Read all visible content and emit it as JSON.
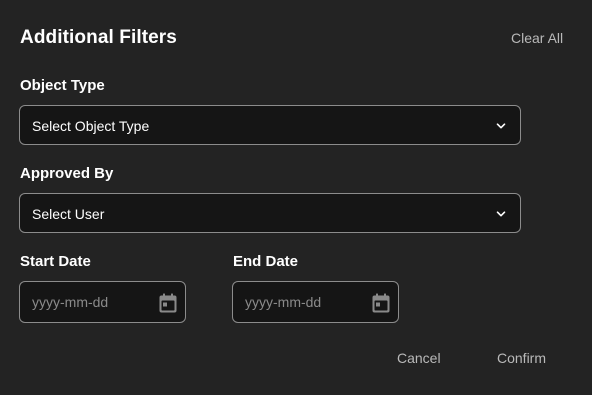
{
  "dialog": {
    "title": "Additional Filters",
    "clear_all_label": "Clear All"
  },
  "object_type": {
    "label": "Object Type",
    "value": "Select Object Type"
  },
  "approved_by": {
    "label": "Approved By",
    "value": "Select User"
  },
  "start_date": {
    "label": "Start Date",
    "placeholder": "yyyy-mm-dd"
  },
  "end_date": {
    "label": "End Date",
    "placeholder": "yyyy-mm-dd"
  },
  "actions": {
    "cancel_label": "Cancel",
    "confirm_label": "Confirm"
  },
  "icons": {
    "dropdown": "chevron-down-icon",
    "date": "calendar-icon"
  },
  "colors": {
    "background": "#232323",
    "field_background": "#151515",
    "field_border": "#8c8c8c",
    "muted_text": "#b9b9b9",
    "placeholder_text": "#8a8a8a"
  }
}
